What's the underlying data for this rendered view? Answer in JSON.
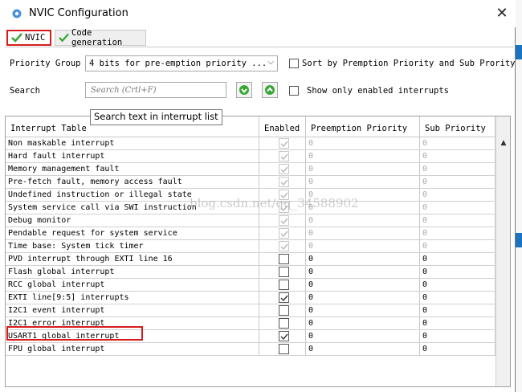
{
  "window": {
    "title": "NVIC Configuration",
    "close_symbol": "✕"
  },
  "tabs": [
    {
      "label": "NVIC",
      "selected": true
    },
    {
      "label": "Code generation",
      "selected": false
    }
  ],
  "priority_group": {
    "label": "Priority Group",
    "value": "4 bits for pre-emption priority ...",
    "sort_label": "Sort by Premption Priority and Sub Prority",
    "sort_checked": false
  },
  "search": {
    "label": "Search",
    "placeholder": "Search (Crtl+F)",
    "show_enabled_label": "Show only enabled interrupts",
    "show_enabled_checked": false,
    "tooltip": "Search text in interrupt list"
  },
  "table": {
    "headers": [
      "Interrupt Table",
      "Enabled",
      "Preemption Priority",
      "Sub Priority"
    ],
    "rows": [
      {
        "name": "Non maskable interrupt",
        "enabled": true,
        "locked": true,
        "pre": "0",
        "sub": "0"
      },
      {
        "name": "Hard fault interrupt",
        "enabled": true,
        "locked": true,
        "pre": "0",
        "sub": "0"
      },
      {
        "name": "Memory management fault",
        "enabled": true,
        "locked": true,
        "pre": "0",
        "sub": "0"
      },
      {
        "name": "Pre-fetch fault, memory access fault",
        "enabled": true,
        "locked": true,
        "pre": "0",
        "sub": "0"
      },
      {
        "name": "Undefined instruction or illegal state",
        "enabled": true,
        "locked": true,
        "pre": "0",
        "sub": "0"
      },
      {
        "name": "System service call via SWI instruction",
        "enabled": true,
        "locked": true,
        "pre": "0",
        "sub": "0"
      },
      {
        "name": "Debug monitor",
        "enabled": true,
        "locked": true,
        "pre": "0",
        "sub": "0"
      },
      {
        "name": "Pendable request for system service",
        "enabled": true,
        "locked": true,
        "pre": "0",
        "sub": "0"
      },
      {
        "name": "Time base: System tick timer",
        "enabled": true,
        "locked": true,
        "pre": "0",
        "sub": "0"
      },
      {
        "name": "PVD interrupt through EXTI line 16",
        "enabled": false,
        "locked": false,
        "pre": "0",
        "sub": "0"
      },
      {
        "name": "Flash global interrupt",
        "enabled": false,
        "locked": false,
        "pre": "0",
        "sub": "0"
      },
      {
        "name": "RCC global interrupt",
        "enabled": false,
        "locked": false,
        "pre": "0",
        "sub": "0"
      },
      {
        "name": "EXTI line[9:5] interrupts",
        "enabled": true,
        "locked": false,
        "pre": "0",
        "sub": "0"
      },
      {
        "name": "I2C1 event interrupt",
        "enabled": false,
        "locked": false,
        "pre": "0",
        "sub": "0"
      },
      {
        "name": "I2C1 error interrupt",
        "enabled": false,
        "locked": false,
        "pre": "0",
        "sub": "0"
      },
      {
        "name": "USART1 global interrupt",
        "enabled": true,
        "locked": false,
        "pre": "0",
        "sub": "0"
      },
      {
        "name": "FPU global interrupt",
        "enabled": false,
        "locked": false,
        "pre": "0",
        "sub": "0"
      }
    ]
  },
  "watermark": "blog.csdn.net/qq_34588902",
  "colors": {
    "accent_green": "#3aa635",
    "highlight_red": "#d81c1c",
    "disabled_gray": "#a9a9a9"
  }
}
